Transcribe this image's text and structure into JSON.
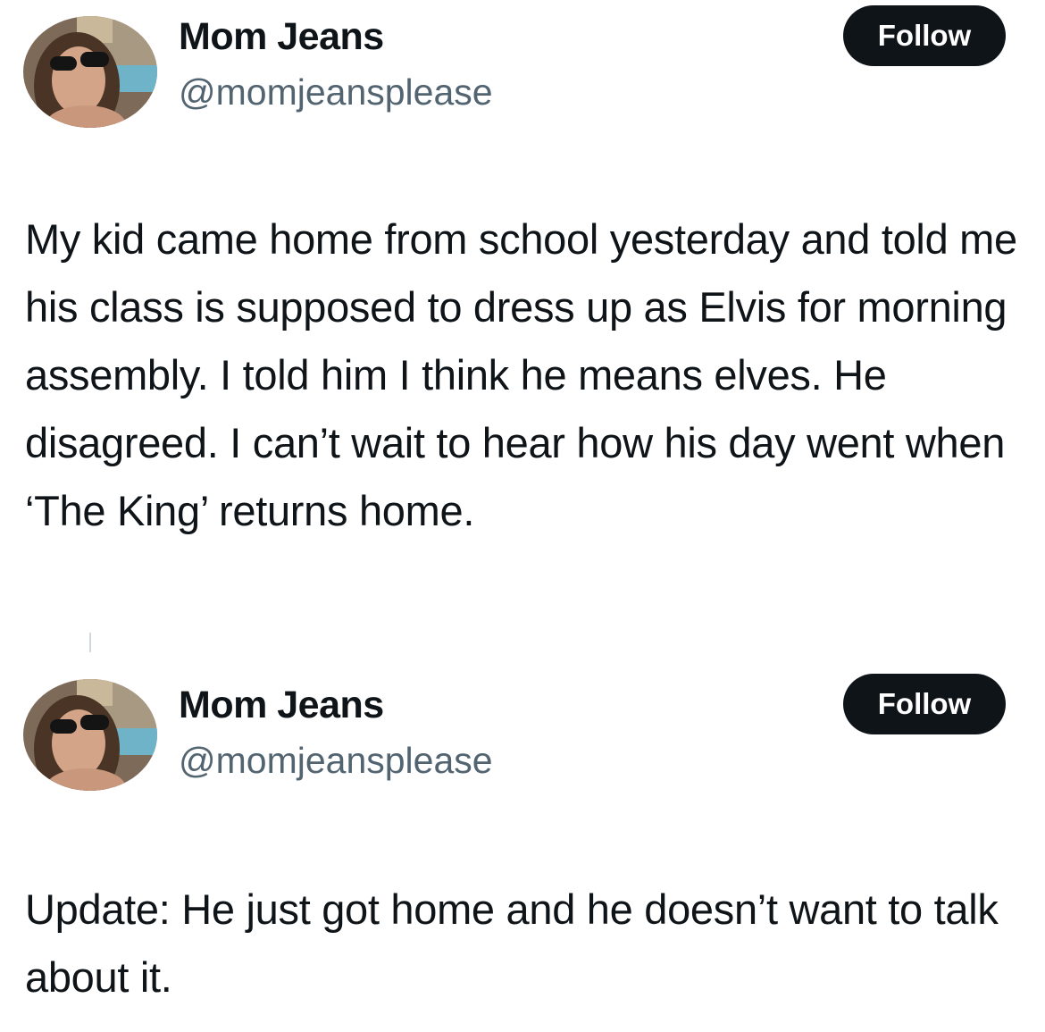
{
  "tweets": [
    {
      "author_name": "Mom Jeans",
      "author_handle": "@momjeansplease",
      "follow_label": "Follow",
      "text": "My kid came home from school yesterday and told me his class is supposed to dress up as Elvis for morning assembly. I told him I think he means elves. He disagreed. I can’t wait to hear how his day went when ‘The King’ returns home."
    },
    {
      "author_name": "Mom Jeans",
      "author_handle": "@momjeansplease",
      "follow_label": "Follow",
      "text": "Update: He just got home and he doesn’t want to talk about it."
    }
  ],
  "colors": {
    "text": "#0f1419",
    "secondary": "#536471",
    "button_bg": "#0f1419",
    "button_text": "#ffffff"
  }
}
